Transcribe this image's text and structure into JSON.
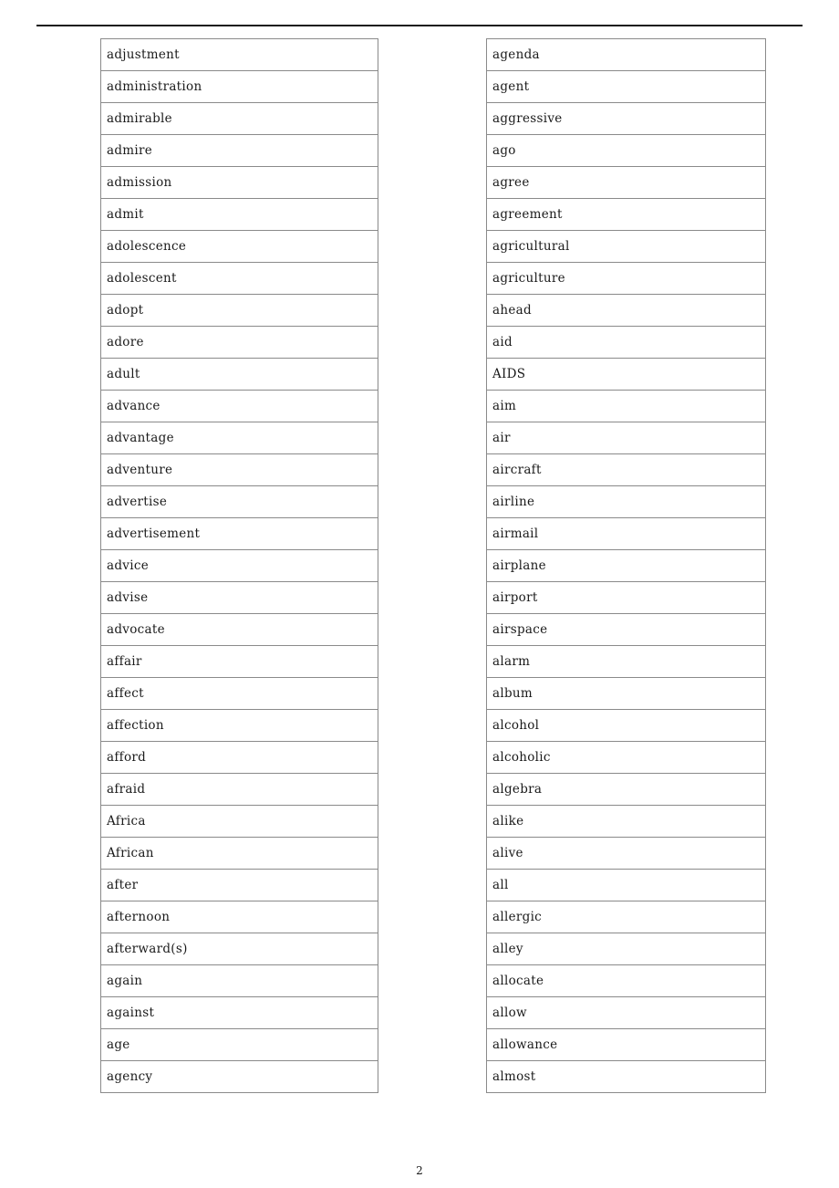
{
  "document": {
    "page_number": "2",
    "header_rule_visible": true,
    "border_color": "#8a8a8a",
    "text_color": "#1a1a1a",
    "rule_color": "#1a1a1a"
  },
  "columns": [
    {
      "name": "left-column",
      "words": [
        "adjustment",
        "administration",
        "admirable",
        "admire",
        "admission",
        "admit",
        "adolescence",
        "adolescent",
        "adopt",
        "adore",
        "adult",
        "advance",
        "advantage",
        "adventure",
        "advertise",
        "advertisement",
        "advice",
        "advise",
        "advocate",
        "affair",
        "affect",
        "affection",
        "afford",
        "afraid",
        "Africa",
        "African",
        "after",
        "afternoon",
        "afterward(s)",
        "again",
        "against",
        "age",
        "agency"
      ]
    },
    {
      "name": "right-column",
      "words": [
        "agenda",
        "agent",
        "aggressive",
        "ago",
        "agree",
        "agreement",
        "agricultural",
        "agriculture",
        "ahead",
        "aid",
        "AIDS",
        "aim",
        "air",
        "aircraft",
        "airline",
        "airmail",
        "airplane",
        "airport",
        "airspace",
        "alarm",
        "album",
        "alcohol",
        "alcoholic",
        "algebra",
        "alike",
        "alive",
        "all",
        "allergic",
        "alley",
        "allocate",
        "allow",
        "allowance",
        "almost"
      ]
    }
  ]
}
